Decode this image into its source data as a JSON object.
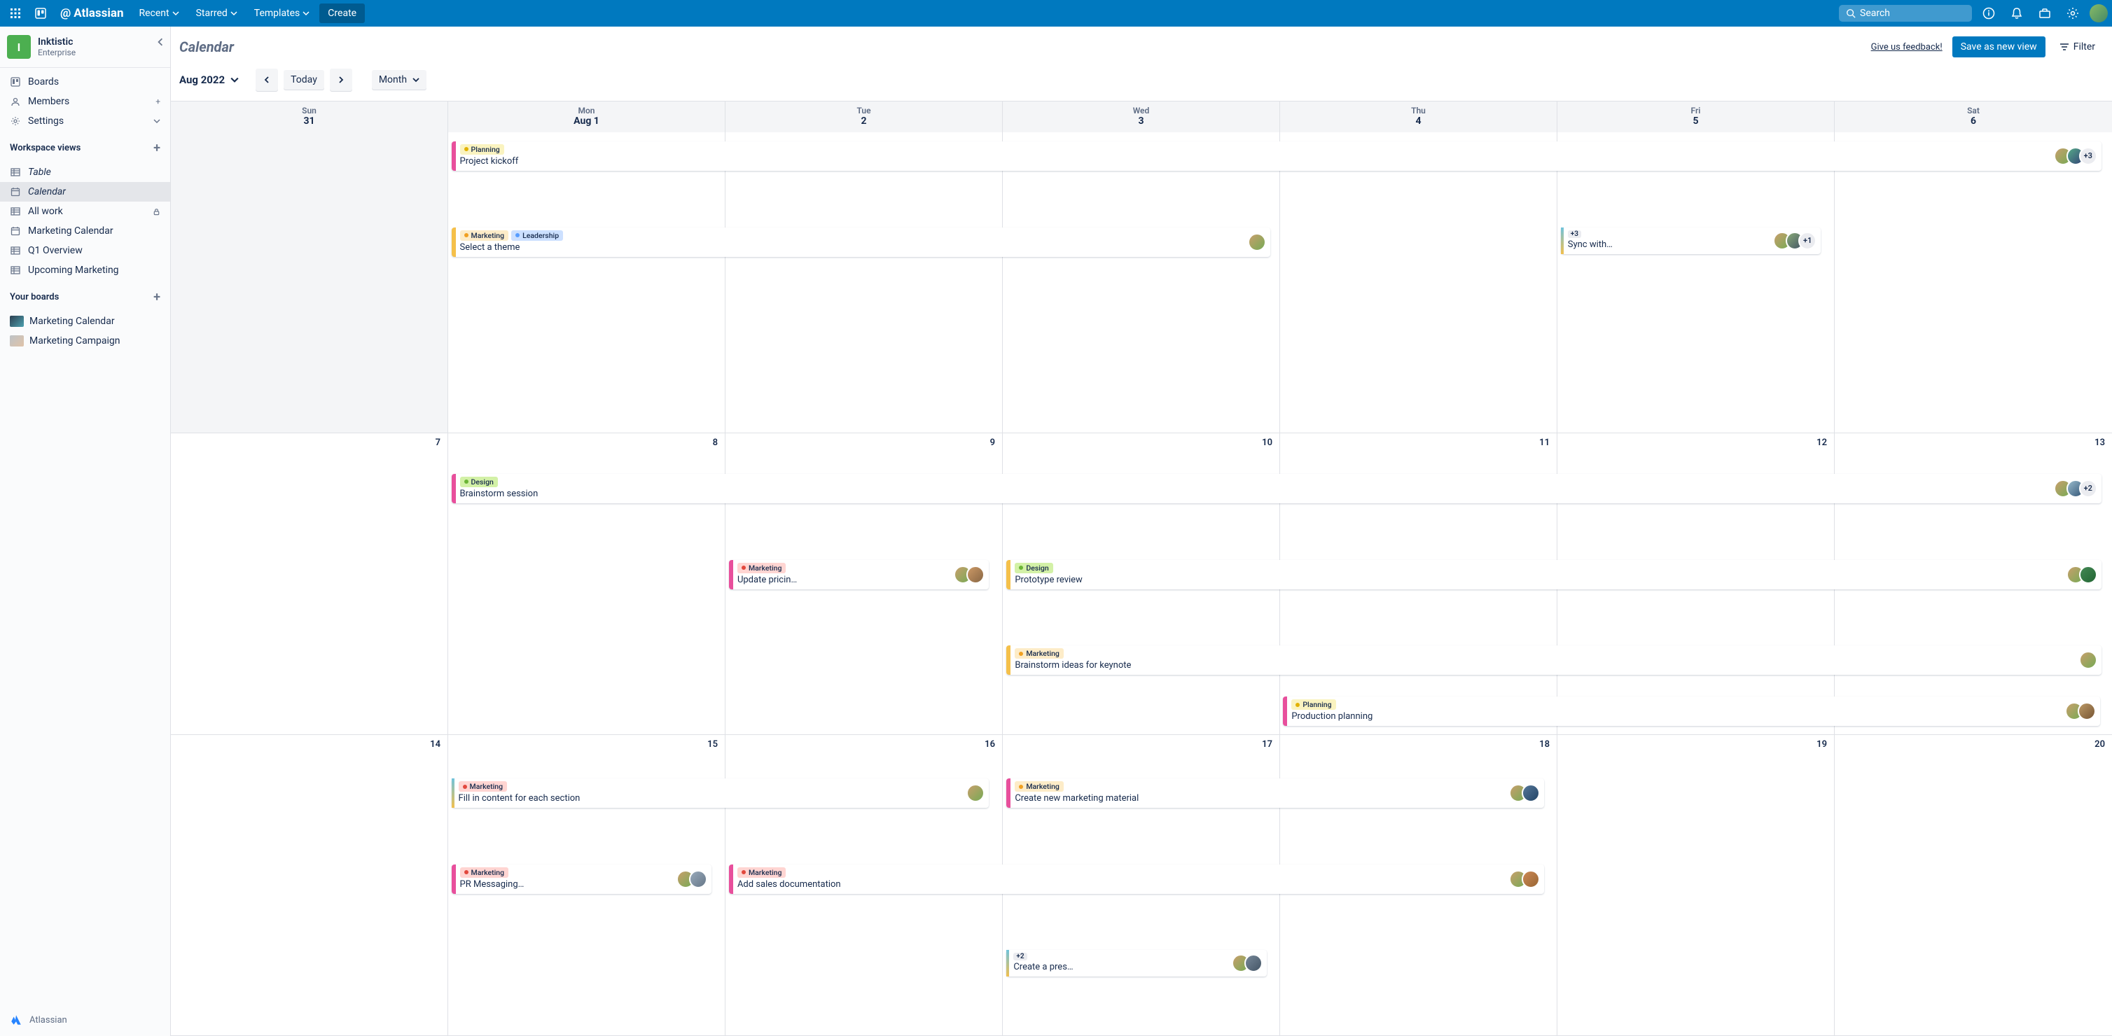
{
  "topbar": {
    "logo": "Atlassian",
    "menu": {
      "recent": "Recent",
      "starred": "Starred",
      "templates": "Templates"
    },
    "create": "Create",
    "search_placeholder": "Search"
  },
  "sidebar": {
    "workspace": {
      "initial": "I",
      "name": "Inktistic",
      "plan": "Enterprise"
    },
    "nav": {
      "boards": "Boards",
      "members": "Members",
      "settings": "Settings"
    },
    "workspace_views_title": "Workspace views",
    "views": {
      "table": "Table",
      "calendar": "Calendar",
      "all_work": "All work",
      "marketing_calendar": "Marketing Calendar",
      "q1_overview": "Q1 Overview",
      "upcoming_marketing": "Upcoming Marketing"
    },
    "your_boards_title": "Your boards",
    "boards": {
      "marketing_calendar": "Marketing Calendar",
      "marketing_campaign": "Marketing Campaign"
    },
    "footer": "Atlassian"
  },
  "header": {
    "title": "Calendar",
    "feedback": "Give us feedback!",
    "save": "Save as new view",
    "filter": "Filter"
  },
  "toolbar": {
    "month": "Aug 2022",
    "today": "Today",
    "view": "Month"
  },
  "week_header": {
    "days": [
      "Sun",
      "Mon",
      "Tue",
      "Wed",
      "Thu",
      "Fri",
      "Sat"
    ],
    "dates": [
      "31",
      "Aug 1",
      "2",
      "3",
      "4",
      "5",
      "6"
    ]
  },
  "row2_dates": [
    "7",
    "8",
    "9",
    "10",
    "11",
    "12",
    "13"
  ],
  "row3_dates": [
    "14",
    "15",
    "16",
    "17",
    "18",
    "19",
    "20"
  ],
  "labels": {
    "planning": "Planning",
    "marketing": "Marketing",
    "leadership": "Leadership",
    "design": "Design"
  },
  "cards": {
    "kickoff": {
      "title": "Project kickoff",
      "extra": "+3"
    },
    "theme": {
      "title": "Select a theme"
    },
    "sync": {
      "title": "Sync with…",
      "badge": "+3",
      "extra": "+1"
    },
    "brainstorm": {
      "title": "Brainstorm session",
      "extra": "+2"
    },
    "pricing": {
      "title": "Update pricin…"
    },
    "prototype": {
      "title": "Prototype review"
    },
    "keynote": {
      "title": "Brainstorm ideas for keynote"
    },
    "production": {
      "title": "Production planning"
    },
    "content": {
      "title": "Fill in content for each section"
    },
    "market": {
      "title": "Create new marketing material"
    },
    "prmsg": {
      "title": "PR Messaging…"
    },
    "salesdoc": {
      "title": "Add sales documentation"
    },
    "pres": {
      "title": "Create a pres…",
      "badge": "+2"
    }
  },
  "colors": {
    "brand": "#0079bf",
    "planning_bg": "#faf3c0",
    "planning_dot": "#e2b203",
    "marketing_bg": "#fdecc8",
    "marketing_dot": "#f0a020",
    "marketing_red_bg": "#ffd5d2",
    "marketing_red_dot": "#e2483d",
    "leadership_bg": "#cce0ff",
    "leadership_dot": "#579dff",
    "design_bg": "#d3f1a7",
    "design_dot": "#6bb536",
    "stripe_pink": "#e84f9c",
    "stripe_yellow": "#f5c04a",
    "stripe_blue": "#6cc3e0",
    "stripe_gradient": "linear-gradient(#6cc3e0,#f5c04a)"
  }
}
